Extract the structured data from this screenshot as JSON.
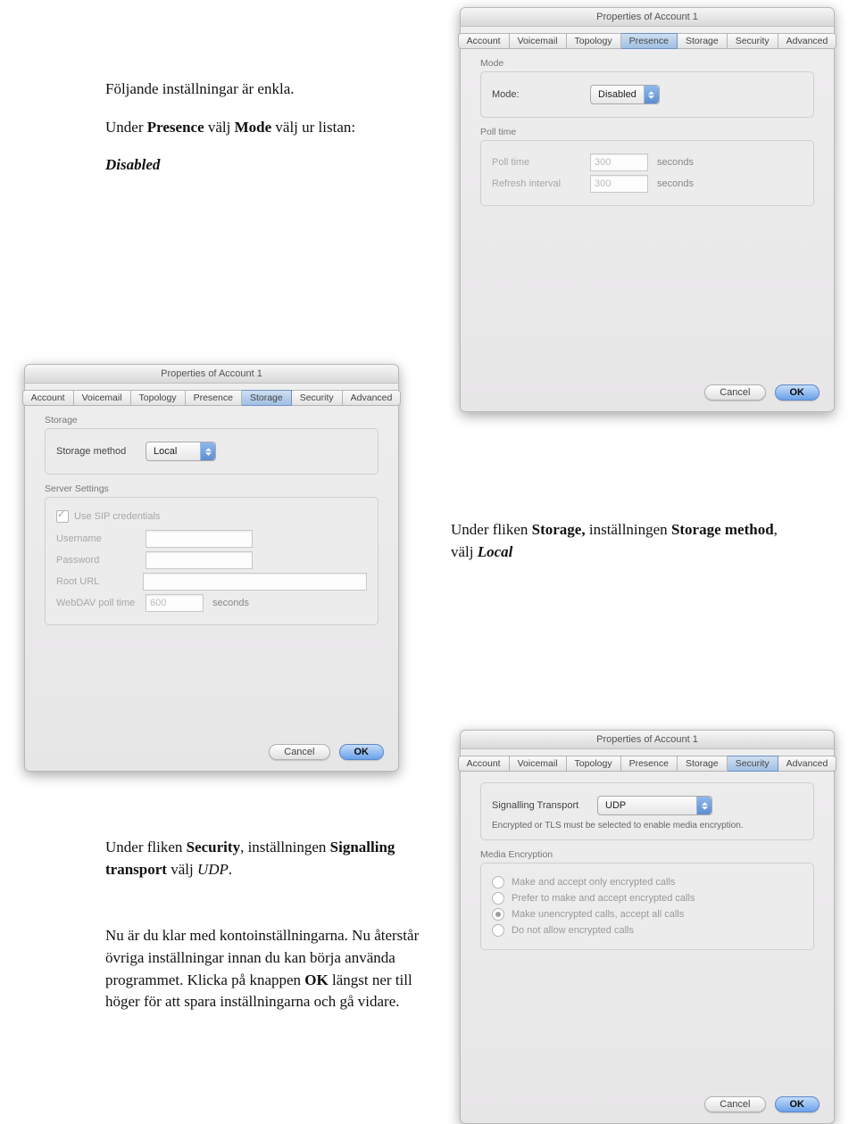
{
  "doc": {
    "p1a": "Följande inställningar är enkla.",
    "p1b_pre": "Under ",
    "p1b_presence": "Presence",
    "p1b_mid": " välj ",
    "p1b_mode": "Mode",
    "p1b_post": " välj ur listan:",
    "p1c": "Disabled",
    "p2_pre": "Under fliken ",
    "p2_storage": "Storage,",
    "p2_mid": " inställningen ",
    "p2_sm": "Storage method",
    "p2_mid2": ", välj ",
    "p2_local": "Local",
    "p3_pre": "Under fliken ",
    "p3_security": "Security",
    "p3_mid": ", inställningen ",
    "p3_st": "Signalling transport",
    "p3_mid2": " välj ",
    "p3_udp": "UDP",
    "p3_post": ".",
    "p4a": "Nu är du klar med kontoinställningarna. Nu återstår övriga inställningar innan du kan börja använda programmet. Klicka på knappen ",
    "p4_ok": "OK",
    "p4b": " längst ner till höger för att spara inställningarna och gå vidare."
  },
  "tabs": [
    "Account",
    "Voicemail",
    "Topology",
    "Presence",
    "Storage",
    "Security",
    "Advanced"
  ],
  "buttons": {
    "cancel": "Cancel",
    "ok": "OK"
  },
  "presence": {
    "title": "Properties of Account 1",
    "mode_section": "Mode",
    "mode_label": "Mode:",
    "mode_value": "Disabled",
    "poll_section": "Poll time",
    "poll_label": "Poll time",
    "poll_value": "300",
    "refresh_label": "Refresh interval",
    "refresh_value": "300",
    "seconds": "seconds"
  },
  "storage": {
    "title": "Properties of Account 1",
    "section": "Storage",
    "method_label": "Storage method",
    "method_value": "Local",
    "server_section": "Server Settings",
    "use_sip": "Use SIP credentials",
    "username": "Username",
    "password": "Password",
    "root_url": "Root URL",
    "webdav_label": "WebDAV poll time",
    "webdav_value": "600",
    "seconds": "seconds"
  },
  "security": {
    "title": "Properties of Account 1",
    "sig_label": "Signalling Transport",
    "sig_value": "UDP",
    "note": "Encrypted or TLS must be selected to enable media encryption.",
    "me_section": "Media Encryption",
    "opt_only": "Make and accept only encrypted calls",
    "opt_prefer": "Prefer to make and accept encrypted calls",
    "opt_unenc": "Make unencrypted calls, accept all calls",
    "opt_noenc": "Do not allow encrypted calls"
  }
}
